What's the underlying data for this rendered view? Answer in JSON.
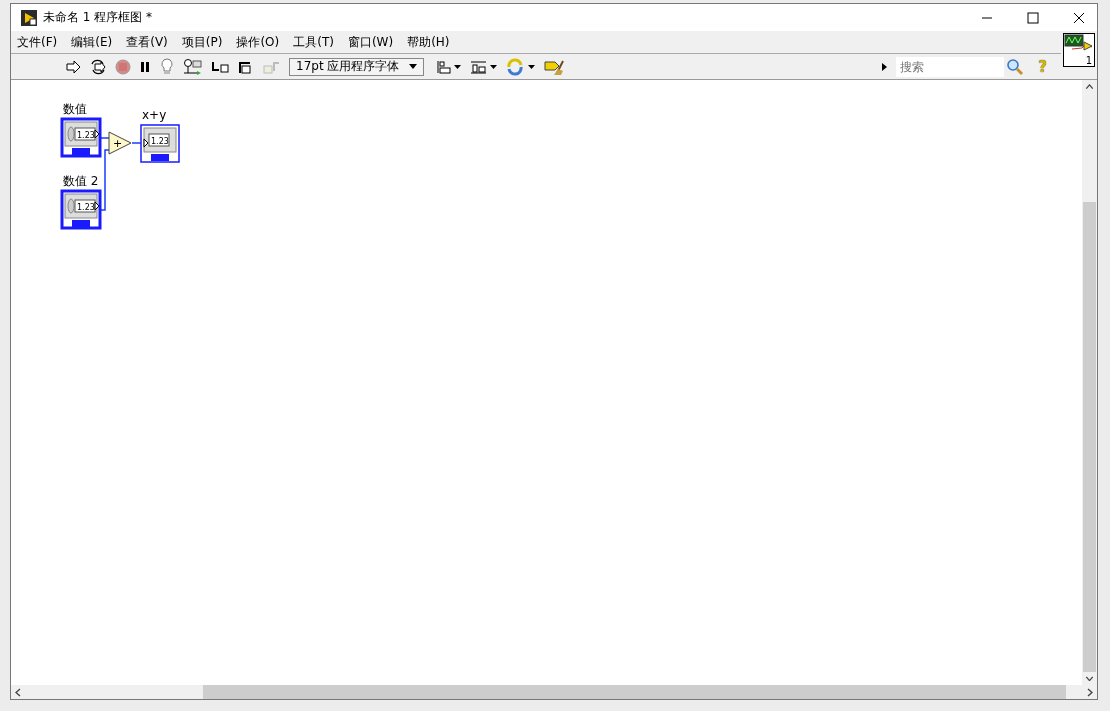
{
  "window": {
    "title": "未命名 1 程序框图 *"
  },
  "menu": [
    "文件(F)",
    "编辑(E)",
    "查看(V)",
    "项目(P)",
    "操作(O)",
    "工具(T)",
    "窗口(W)",
    "帮助(H)"
  ],
  "toolbar": {
    "font": "17pt 应用程序字体",
    "search": {
      "placeholder": "搜索"
    },
    "help": "?",
    "vi_icon_number": "1"
  },
  "diagram": {
    "nodes": [
      {
        "kind": "control",
        "label": "数值",
        "value": "1.23"
      },
      {
        "kind": "control",
        "label": "数值 2",
        "value": "1.23"
      },
      {
        "kind": "add",
        "symbol": "+"
      },
      {
        "kind": "indicator",
        "label": "x+y",
        "value": "1.23"
      }
    ]
  }
}
